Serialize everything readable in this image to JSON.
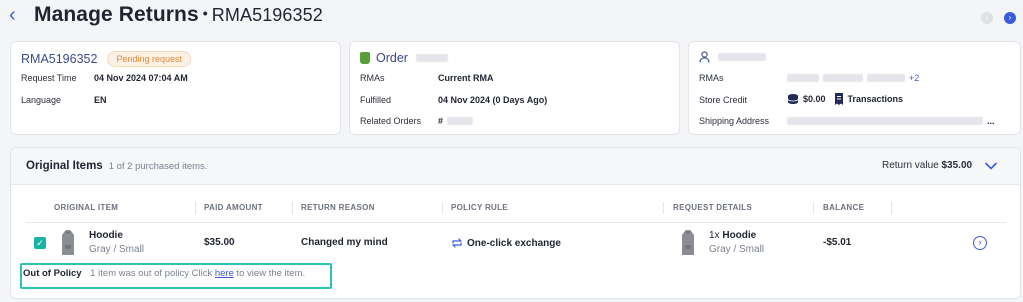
{
  "header": {
    "back_glyph": "‹",
    "title": "Manage Returns",
    "separator": "•",
    "rma": "RMA5196352"
  },
  "request_card": {
    "rma": "RMA5196352",
    "status_badge": "Pending request",
    "rows": [
      {
        "label": "Request Time",
        "value": "04 Nov 2024 07:04 AM"
      },
      {
        "label": "Language",
        "value": "EN"
      }
    ]
  },
  "order_card": {
    "title": "Order",
    "rows": [
      {
        "label": "RMAs",
        "value": "Current RMA"
      },
      {
        "label": "Fulfilled",
        "value": "04 Nov 2024 (0 Days Ago)"
      },
      {
        "label": "Related Orders",
        "value": "#"
      }
    ]
  },
  "customer_card": {
    "rows": [
      {
        "label": "RMAs",
        "value": "",
        "more": "+2"
      },
      {
        "label": "Store Credit",
        "value": "$0.00",
        "extra": "Transactions"
      },
      {
        "label": "Shipping Address",
        "value": "",
        "suffix": "..."
      }
    ]
  },
  "items": {
    "title": "Original Items",
    "subtitle": "1 of 2 purchased items.",
    "return_value_label": "Return value",
    "return_value": "$35.00",
    "columns": [
      "ORIGINAL ITEM",
      "PAID AMOUNT",
      "RETURN REASON",
      "POLICY RULE",
      "REQUEST DETAILS",
      "BALANCE"
    ],
    "rows": [
      {
        "name": "Hoodie",
        "variant": "Gray / Small",
        "paid": "$35.00",
        "reason": "Changed my mind",
        "policy": "One-click exchange",
        "request_qty": "1x",
        "request_name": "Hoodie",
        "request_variant": "Gray / Small",
        "balance": "-$5.01"
      }
    ],
    "out_of_policy": {
      "label": "Out of Policy",
      "text_before": "1 item was out of policy Click",
      "link": "here",
      "text_after": "to view the item."
    }
  },
  "colors": {
    "accent": "#3b5bdb",
    "teal": "#17b3a3",
    "badge_text": "#e58a3a"
  }
}
